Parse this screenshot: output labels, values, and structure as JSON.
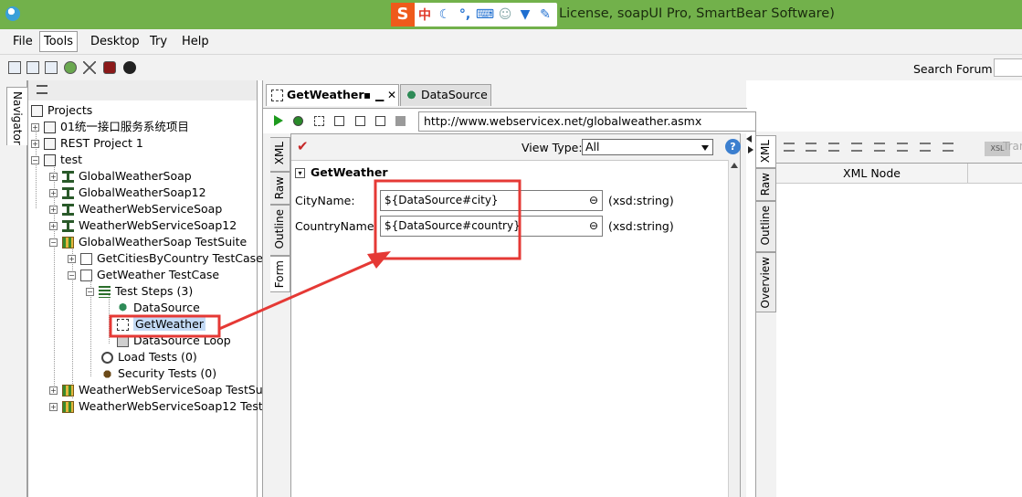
{
  "window": {
    "title": "License, soapUI Pro, SmartBear Software)",
    "ime_logo": "S",
    "ime_mode": "中"
  },
  "menu": {
    "items": [
      {
        "label": "File",
        "accel": "F"
      },
      {
        "label": "Tools",
        "accel": "T"
      },
      {
        "label": "Desktop",
        "accel": "D"
      },
      {
        "label": "Try",
        "accel": "y"
      },
      {
        "label": "Help",
        "accel": "H"
      }
    ],
    "active_index": 1
  },
  "toolbar": {
    "search_label": "Search Forum"
  },
  "navigator": {
    "tab_label": "Navigator",
    "tree": [
      {
        "label": "Projects",
        "icon": "projects-icon"
      },
      {
        "label": "01统一接口服务系统项目",
        "icon": "project-icon"
      },
      {
        "label": "REST Project 1",
        "icon": "project-icon"
      },
      {
        "label": "test",
        "icon": "project-icon"
      },
      {
        "label": "GlobalWeatherSoap",
        "icon": "soap-interface-icon"
      },
      {
        "label": "GlobalWeatherSoap12",
        "icon": "soap-interface-icon"
      },
      {
        "label": "WeatherWebServiceSoap",
        "icon": "soap-interface-icon"
      },
      {
        "label": "WeatherWebServiceSoap12",
        "icon": "soap-interface-icon"
      },
      {
        "label": "GlobalWeatherSoap TestSuite",
        "icon": "testsuite-icon"
      },
      {
        "label": "GetCitiesByCountry TestCase",
        "icon": "testcase-icon"
      },
      {
        "label": "GetWeather TestCase",
        "icon": "testcase-icon"
      },
      {
        "label": "Test Steps (3)",
        "icon": "teststeps-icon"
      },
      {
        "label": "DataSource",
        "icon": "datasource-icon"
      },
      {
        "label": "GetWeather",
        "icon": "soap-request-icon"
      },
      {
        "label": "DataSource Loop",
        "icon": "datasource-loop-icon"
      },
      {
        "label": "Load Tests (0)",
        "icon": "load-test-icon"
      },
      {
        "label": "Security Tests (0)",
        "icon": "security-test-icon"
      },
      {
        "label": "WeatherWebServiceSoap TestSu",
        "icon": "testsuite-icon"
      },
      {
        "label": "WeatherWebServiceSoap12 Test",
        "icon": "testsuite-icon"
      }
    ],
    "selected": "GetWeather"
  },
  "editor": {
    "tabs": [
      {
        "label": "GetWeather",
        "active": true
      },
      {
        "label": "DataSource",
        "active": false
      }
    ],
    "endpoint_url": "http://www.webservicex.net/globalweather.asmx",
    "view_type_label": "View Type:",
    "view_type_value": "All",
    "help_glyph": "?",
    "side_tabs": [
      "XML",
      "Raw",
      "Outline",
      "Form"
    ],
    "form": {
      "section_title": "GetWeather",
      "fields": [
        {
          "label": "CityName:",
          "value": "${DataSource#city}",
          "type": "(xsd:string)"
        },
        {
          "label": "CountryName:",
          "value": "${DataSource#country}",
          "type": "(xsd:string)"
        }
      ]
    }
  },
  "response": {
    "side_tabs": [
      "XML",
      "Raw",
      "Outline",
      "Overview"
    ],
    "xsl_label": "XSL",
    "transfer_label": "Tran",
    "grid_header": "XML Node"
  },
  "annotation": {
    "color": "#e53935"
  }
}
